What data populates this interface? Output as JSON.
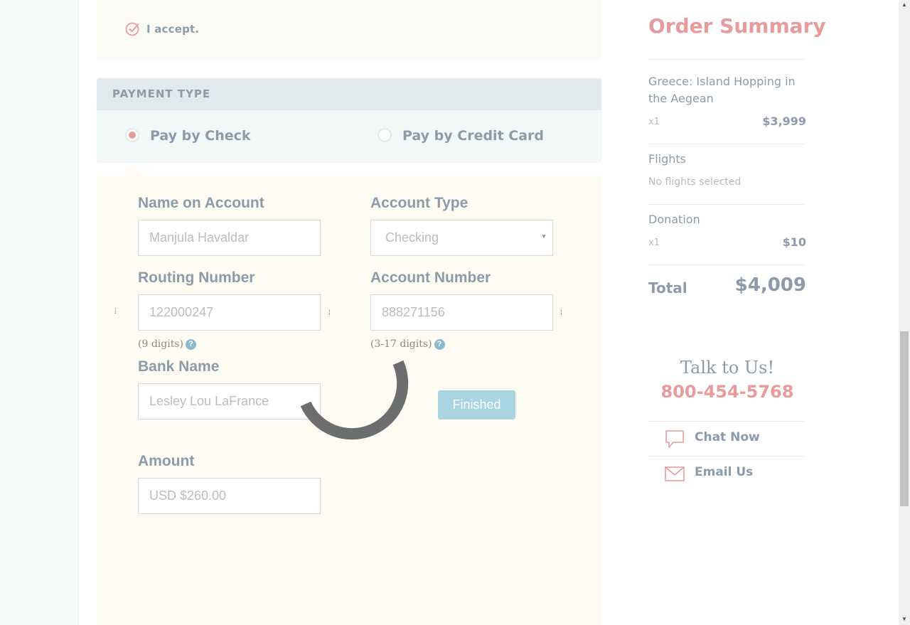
{
  "terms": {
    "accept_label": "I accept."
  },
  "payment": {
    "header": "PAYMENT TYPE",
    "options": [
      {
        "label": "Pay by Check",
        "selected": true
      },
      {
        "label": "Pay by Credit Card",
        "selected": false
      }
    ]
  },
  "check_form": {
    "name_on_account": {
      "label": "Name on Account",
      "value": "Manjula Havaldar"
    },
    "account_type": {
      "label": "Account Type",
      "value": "Checking"
    },
    "routing_number": {
      "label": "Routing Number",
      "value": "122000247",
      "hint": "(9 digits)"
    },
    "account_number": {
      "label": "Account Number",
      "value": "888271156",
      "hint": "(3-17 digits)"
    },
    "bank_name": {
      "label": "Bank Name",
      "value": "Lesley Lou LaFrance"
    },
    "amount": {
      "label": "Amount",
      "value": "USD $260.00"
    },
    "finished_label": "Finished",
    "help_glyph": "?",
    "drag_glyph": "⁞"
  },
  "order_summary": {
    "title": "Order Summary",
    "trip": {
      "name": "Greece: Island Hopping in the Aegean",
      "qty": "x1",
      "price": "$3,999"
    },
    "flights": {
      "name": "Flights",
      "note": "No flights selected"
    },
    "donation": {
      "name": "Donation",
      "qty": "x1",
      "price": "$10"
    },
    "total_label": "Total",
    "total_value": "$4,009"
  },
  "contact": {
    "title": "Talk to Us!",
    "phone": "800-454-5768",
    "chat_label": "Chat Now",
    "email_label": "Email Us"
  },
  "colors": {
    "accent": "#e89b9b",
    "text": "#8b9bac",
    "button": "#a8d5e1"
  }
}
